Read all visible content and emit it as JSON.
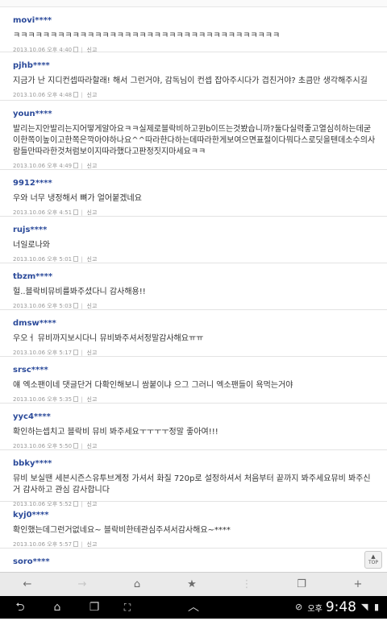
{
  "comments": [
    {
      "user": "movi****",
      "text": "ㅋㅋㅋㅋㅋㅋㅋㅋㅋㅋㅋㅋㅋㅋㅋㅋㅋㅋㅋㅋㅋㅋㅋㅋㅋㅋㅋㅋㅋㅋㅋㅋㅋㅋㅋㅋ",
      "date": "2013.10.06 오후 4:40",
      "report": "신고"
    },
    {
      "user": "pjhb****",
      "text": "지금가 난 지디컨셉따라할래! 해서 그런거야, 감독님이 컨셉 잡아주시다가 겹친거야? 초큼만 생각해주시길",
      "date": "2013.10.06 오후 4:48",
      "report": "신고"
    },
    {
      "user": "youn****",
      "text": "발리는지안발리는지어떻게알아요ㅋㅋ실제로블락비하고윈b이뜨는것봤습니까?둘다실력좋고열심히하는데굳이한쪽이높이고한쪽은깍아야하나요^^따라한다하는데따라한게보여으면표절이다뭐다스로딧을텐데소수의사람들만따라한것처럼보이지따라했다고판정짓지마세요ㅋㅋ",
      "date": "2013.10.06 오후 4:49",
      "report": "신고"
    },
    {
      "user": "9912****",
      "text": "우와 너무 냉정해서 뼈가 얼어붙겠네요",
      "date": "2013.10.06 오후 4:51",
      "report": "신고"
    },
    {
      "user": "rujs****",
      "text": "너일로나와",
      "date": "2013.10.06 오후 5:01",
      "report": "신고"
    },
    {
      "user": "tbzm****",
      "text": "헐..블락비뮤비를봐주셨다니 감사해용!!",
      "date": "2013.10.06 오후 5:03",
      "report": "신고"
    },
    {
      "user": "dmsw****",
      "text": "우오ㅓ 뮤비까지보시다니 뮤비봐주셔서정말감사해요ㅠㅠ",
      "date": "2013.10.06 오후 5:17",
      "report": "신고"
    },
    {
      "user": "srsc****",
      "text": "얘 엑소팬이네 댓글단거 다확인해보니 쌈붙이냐 으그 그러니 엑소팬들이 욕먹는거야",
      "date": "2013.10.06 오후 5:35",
      "report": "신고"
    },
    {
      "user": "yyc4****",
      "text": "확인하는셉치고 블락비 뮤비 봐주세요ㅜㅜㅜㅜ정말 좋아여!!!",
      "date": "2013.10.06 오후 5:50",
      "report": "신고"
    },
    {
      "user": "bbky****",
      "text": "뮤비 보실땐 세븐시즌스유투브계정 가셔서 화질 720p로 설정하셔서 처음부터 끝까지 봐주세요뮤비 봐주신거 감사하고 관심 감사합니다",
      "date": "2013.10.06 오후 5:52",
      "report": "신고"
    },
    {
      "user": "kyj0****",
      "text": "확인했는데그런거없네요~ 블락비한테관심주셔서감사해요~****",
      "date": "2013.10.06 오후 5:57",
      "report": "신고"
    },
    {
      "user": "soro****",
      "text": "",
      "date": "",
      "report": ""
    }
  ],
  "top_button": {
    "label": "TOP"
  },
  "browser_bar": {
    "back_icon": "←",
    "forward_icon": "→",
    "home_icon": "⌂",
    "bookmark_icon": "★",
    "tabs_icon": "❐",
    "new_tab_icon": "+"
  },
  "system_bar": {
    "ampm": "오후",
    "time": "9:48"
  }
}
